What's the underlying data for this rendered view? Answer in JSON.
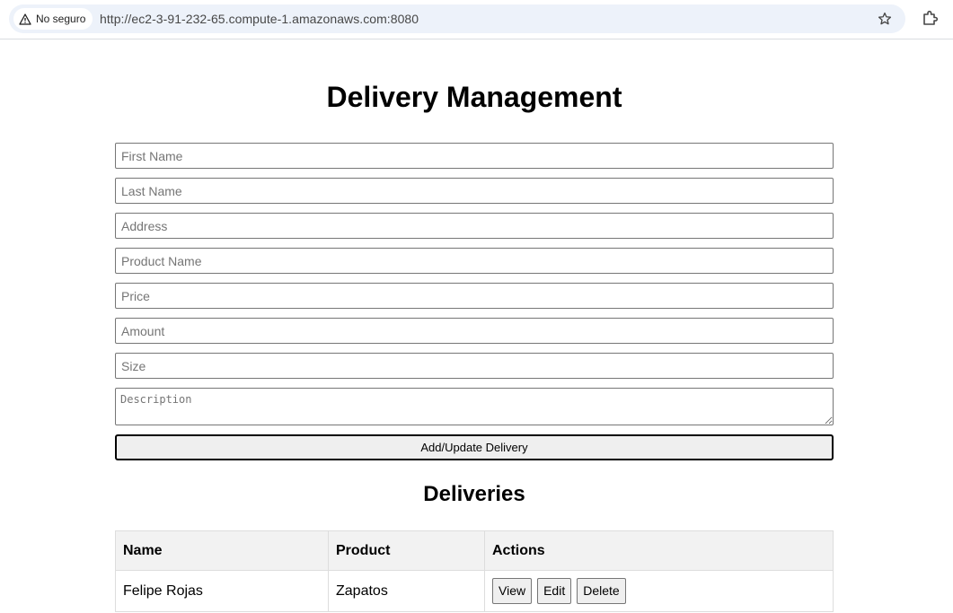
{
  "browser": {
    "security_label": "No seguro",
    "url": "http://ec2-3-91-232-65.compute-1.amazonaws.com:8080",
    "icons": [
      "warning-icon",
      "star-icon",
      "extensions-icon"
    ]
  },
  "page": {
    "title": "Delivery Management"
  },
  "form": {
    "first_name_placeholder": "First Name",
    "last_name_placeholder": "Last Name",
    "address_placeholder": "Address",
    "product_name_placeholder": "Product Name",
    "price_placeholder": "Price",
    "amount_placeholder": "Amount",
    "size_placeholder": "Size",
    "description_placeholder": "Description",
    "submit_label": "Add/Update Delivery"
  },
  "deliveries": {
    "heading": "Deliveries",
    "columns": [
      "Name",
      "Product",
      "Actions"
    ],
    "rows": [
      {
        "name": "Felipe Rojas",
        "product": "Zapatos",
        "actions": [
          "View",
          "Edit",
          "Delete"
        ]
      }
    ]
  }
}
